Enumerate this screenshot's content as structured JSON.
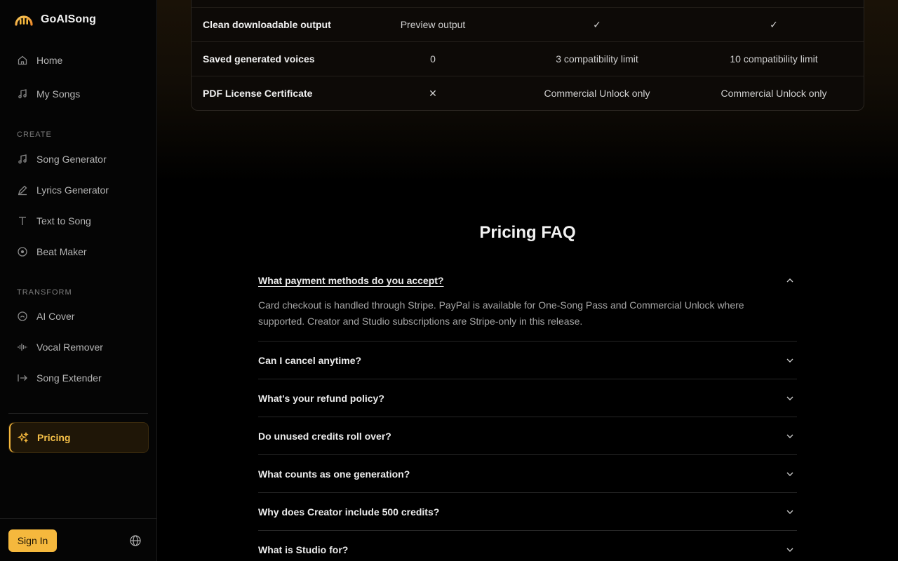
{
  "brand": {
    "name": "GoAISong",
    "accent": "#f5b83d"
  },
  "sidebar": {
    "top_items": [
      {
        "label": "Home",
        "icon": "home-icon"
      },
      {
        "label": "My Songs",
        "icon": "music-icon"
      }
    ],
    "create_label": "CREATE",
    "create_items": [
      {
        "label": "Song Generator",
        "icon": "music-note-icon"
      },
      {
        "label": "Lyrics Generator",
        "icon": "pencil-icon"
      },
      {
        "label": "Text to Song",
        "icon": "text-icon"
      },
      {
        "label": "Beat Maker",
        "icon": "disc-icon"
      }
    ],
    "transform_label": "TRANSFORM",
    "transform_items": [
      {
        "label": "AI Cover",
        "icon": "cover-icon"
      },
      {
        "label": "Vocal Remover",
        "icon": "waveform-icon"
      },
      {
        "label": "Song Extender",
        "icon": "arrow-right-bar-icon"
      }
    ],
    "pricing_label": "Pricing",
    "sign_in": "Sign In"
  },
  "table": {
    "rows": [
      {
        "feature": "Clean downloadable output",
        "free": "Preview output",
        "plan2": "✓",
        "plan3": "✓"
      },
      {
        "feature": "Saved generated voices",
        "free": "0",
        "plan2": "3 compatibility limit",
        "plan3": "10 compatibility limit"
      },
      {
        "feature": "PDF License Certificate",
        "free": "✕",
        "plan2": "Commercial Unlock only",
        "plan3": "Commercial Unlock only"
      }
    ]
  },
  "faq": {
    "title": "Pricing FAQ",
    "items": [
      {
        "q": "What payment methods do you accept?",
        "a": "Card checkout is handled through Stripe. PayPal is available for One-Song Pass and Commercial Unlock where supported. Creator and Studio subscriptions are Stripe-only in this release.",
        "open": true
      },
      {
        "q": "Can I cancel anytime?"
      },
      {
        "q": "What's your refund policy?"
      },
      {
        "q": "Do unused credits roll over?"
      },
      {
        "q": "What counts as one generation?"
      },
      {
        "q": "Why does Creator include 500 credits?"
      },
      {
        "q": "What is Studio for?"
      }
    ]
  }
}
